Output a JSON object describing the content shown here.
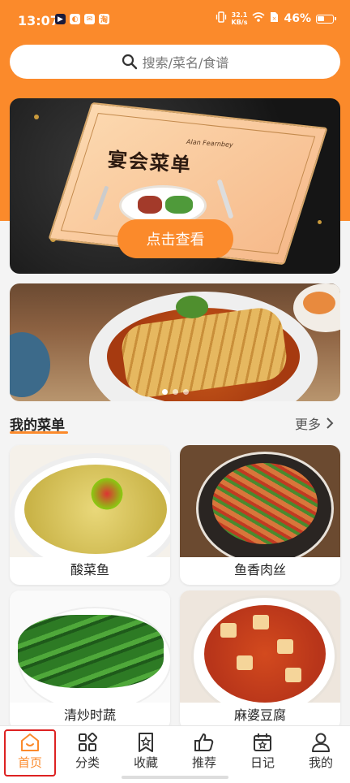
{
  "status_bar": {
    "time": "13:07",
    "net_speed_value": "32.1",
    "net_speed_unit": "KB/s",
    "battery": "46%"
  },
  "search": {
    "placeholder": "搜索/菜名/食谱"
  },
  "banner": {
    "menu_title": "宴会菜单",
    "menu_subtitle": "Alan Fearnbey",
    "cta": "点击查看"
  },
  "carousel": {
    "pages": 3,
    "active": 1
  },
  "my_menu": {
    "title": "我的菜单",
    "more": "更多"
  },
  "dishes": [
    {
      "name": "酸菜鱼"
    },
    {
      "name": "鱼香肉丝"
    },
    {
      "name": "清炒时蔬"
    },
    {
      "name": "麻婆豆腐"
    }
  ],
  "tabs": [
    {
      "label": "首页",
      "icon": "home-icon",
      "active": true
    },
    {
      "label": "分类",
      "icon": "grid-icon",
      "active": false
    },
    {
      "label": "收藏",
      "icon": "bookmark-star-icon",
      "active": false
    },
    {
      "label": "推荐",
      "icon": "thumbs-up-icon",
      "active": false
    },
    {
      "label": "日记",
      "icon": "calendar-icon",
      "active": false
    },
    {
      "label": "我的",
      "icon": "person-icon",
      "active": false
    }
  ],
  "colors": {
    "accent": "#fb8a2b",
    "highlight_frame": "#dd2222"
  }
}
